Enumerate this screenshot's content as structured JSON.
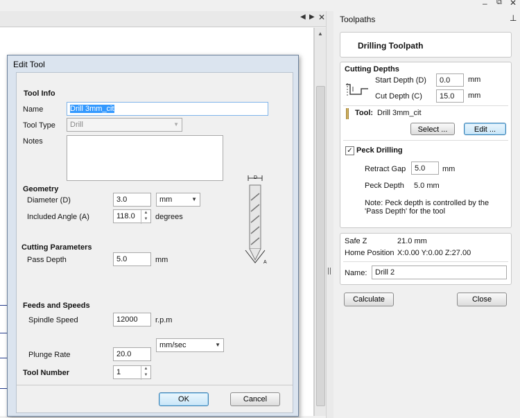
{
  "panel": {
    "title": "Toolpaths",
    "heading": "Drilling Toolpath",
    "cutting_depths": {
      "title": "Cutting Depths",
      "start_depth_label": "Start Depth (D)",
      "start_depth_value": "0.0",
      "cut_depth_label": "Cut Depth (C)",
      "cut_depth_value": "15.0",
      "unit": "mm"
    },
    "tool": {
      "label": "Tool:",
      "name": "Drill 3mm_cit",
      "select_label": "Select ...",
      "edit_label": "Edit ..."
    },
    "peck": {
      "checked": "✓",
      "title": "Peck Drilling",
      "retract_gap_label": "Retract Gap",
      "retract_gap_value": "5.0",
      "unit": "mm",
      "peck_depth_label": "Peck Depth",
      "peck_depth_value": "5.0 mm",
      "note_line1": "Note: Peck depth is controlled by the",
      "note_line2": "'Pass Depth' for the tool"
    },
    "info": {
      "safe_z_label": "Safe Z",
      "safe_z_value": "21.0 mm",
      "home_label": "Home Position",
      "home_value": "X:0.00 Y:0.00 Z:27.00",
      "name_label": "Name:",
      "name_value": "Drill 2"
    },
    "calculate_label": "Calculate",
    "close_label": "Close"
  },
  "dialog": {
    "title": "Edit Tool",
    "tool_info": "Tool Info",
    "name_label": "Name",
    "name_value": "Drill 3mm_cit",
    "tool_type_label": "Tool Type",
    "tool_type_value": "Drill",
    "notes_label": "Notes",
    "geometry": "Geometry",
    "diameter_label": "Diameter (D)",
    "diameter_value": "3.0",
    "diameter_unit": "mm",
    "included_angle_label": "Included Angle (A)",
    "included_angle_value": "118.0",
    "degrees": "degrees",
    "cutting_parameters": "Cutting Parameters",
    "pass_depth_label": "Pass Depth",
    "pass_depth_value": "5.0",
    "mm": "mm",
    "feeds_speeds": "Feeds and Speeds",
    "spindle_label": "Spindle Speed",
    "spindle_value": "12000",
    "rpm": "r.p.m",
    "plunge_label": "Plunge Rate",
    "plunge_value": "20.0",
    "plunge_unit": "mm/sec",
    "tool_number_label": "Tool Number",
    "tool_number_value": "1",
    "ok_label": "OK",
    "cancel_label": "Cancel",
    "diagram_d": "D",
    "diagram_a": "A"
  }
}
